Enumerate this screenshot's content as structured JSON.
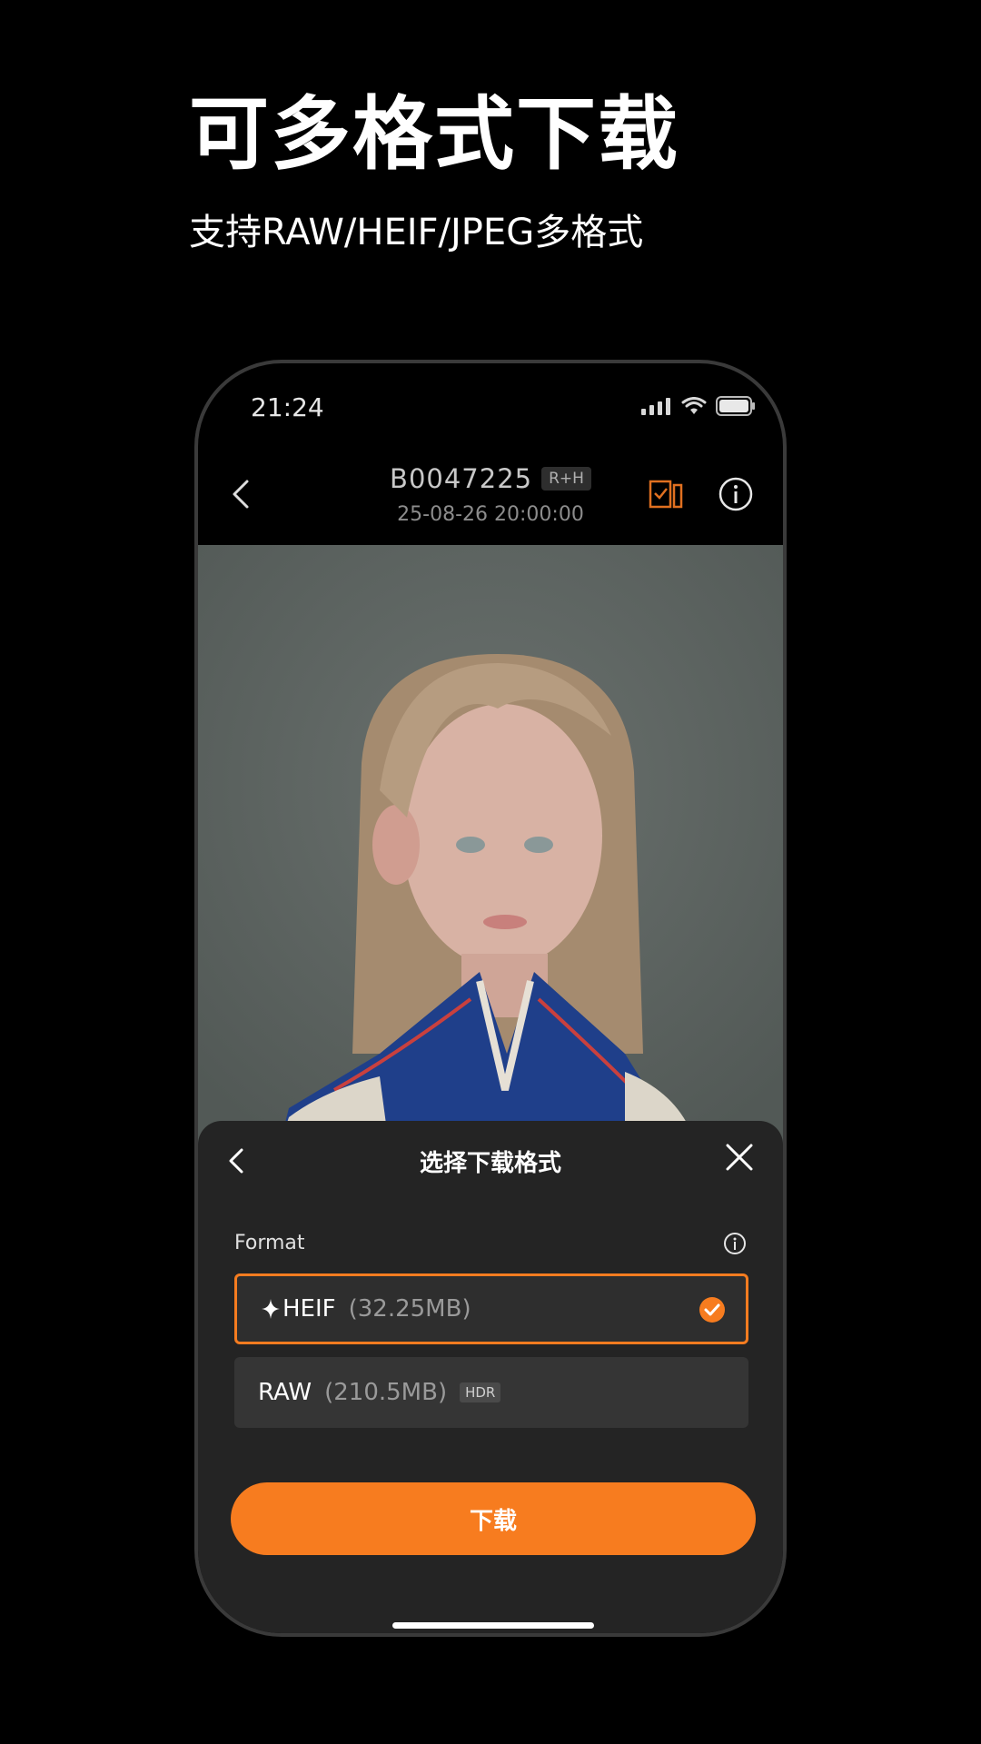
{
  "hero": {
    "title": "可多格式下载",
    "subtitle": "支持RAW/HEIF/JPEG多格式"
  },
  "status_bar": {
    "time": "21:24",
    "icons": [
      "signal-icon",
      "wifi-icon",
      "battery-icon"
    ]
  },
  "nav": {
    "album_id": "B0047225",
    "badge": "R+H",
    "date": "25-08-26 20:00:00",
    "icons": [
      "back-icon",
      "select-icon",
      "info-icon"
    ]
  },
  "photo": {
    "icons": [
      "histogram-icon"
    ]
  },
  "sheet": {
    "title": "选择下载格式",
    "format_label": "Format",
    "options": [
      {
        "name": "HEIF",
        "size": "(32.25MB)",
        "selected": true
      },
      {
        "name": "RAW",
        "size": "(210.5MB)",
        "badge": "HDR",
        "selected": false
      }
    ],
    "download_label": "下载"
  },
  "colors": {
    "accent": "#f77c1f",
    "background": "#000000",
    "sheet_bg": "#242424"
  }
}
